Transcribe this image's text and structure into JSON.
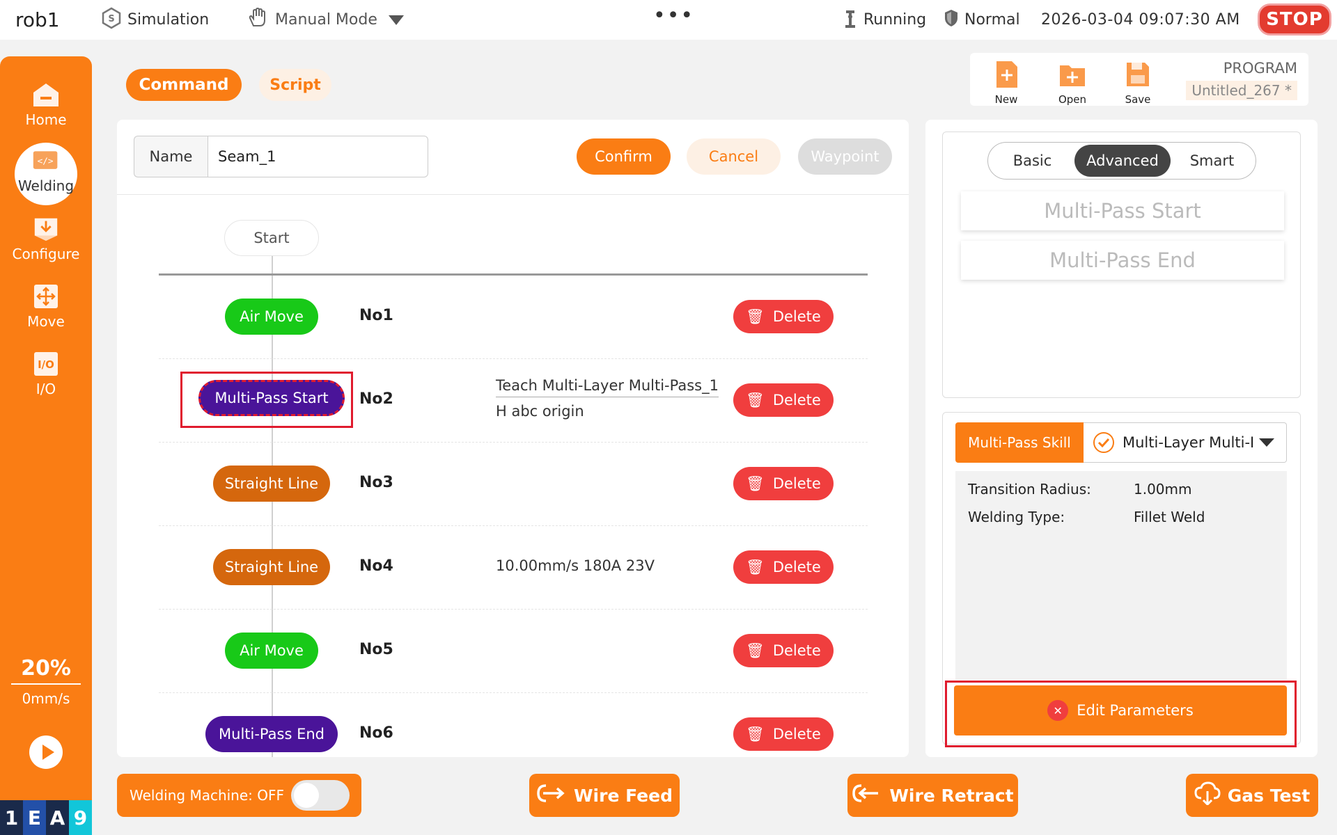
{
  "topbar": {
    "robot_name": "rob1",
    "simulation": "Simulation",
    "mode": "Manual Mode",
    "more": "•••",
    "state": "Running",
    "safety": "Normal",
    "datetime": "2026-03-04 09:07:30 AM",
    "stop": "STOP"
  },
  "sidebar": {
    "items": [
      {
        "label": "Home"
      },
      {
        "label": "Welding"
      },
      {
        "label": "Configure"
      },
      {
        "label": "Move"
      },
      {
        "label": "I/O"
      }
    ],
    "speed_pct": "20%",
    "speed_mms": "0mm/s",
    "logo": [
      "1",
      "E",
      "A",
      "9"
    ]
  },
  "tabs": {
    "command": "Command",
    "script": "Script"
  },
  "program": {
    "new": "New",
    "open": "Open",
    "save": "Save",
    "label": "PROGRAM",
    "name": "Untitled_267 *"
  },
  "command": {
    "name_label": "Name",
    "name_value": "Seam_1",
    "confirm": "Confirm",
    "cancel": "Cancel",
    "waypoint": "Waypoint",
    "start": "Start",
    "delete_label": "Delete",
    "steps": [
      {
        "node": "Air Move",
        "no": "No1",
        "desc1": "",
        "desc2": ""
      },
      {
        "node": "Multi-Pass Start",
        "no": "No2",
        "desc1": "Teach Multi-Layer Multi-Pass_1",
        "desc2": "H abc origin"
      },
      {
        "node": "Straight Line",
        "no": "No3",
        "desc1": "",
        "desc2": ""
      },
      {
        "node": "Straight Line",
        "no": "No4",
        "desc1": "10.00mm/s 180A 23V",
        "desc2": ""
      },
      {
        "node": "Air Move",
        "no": "No5",
        "desc1": "",
        "desc2": ""
      },
      {
        "node": "Multi-Pass End",
        "no": "No6",
        "desc1": "",
        "desc2": ""
      }
    ]
  },
  "right": {
    "segments": [
      "Basic",
      "Advanced",
      "Smart"
    ],
    "skills": [
      "Multi-Pass Start",
      "Multi-Pass End"
    ],
    "mp_tab": "Multi-Pass Skill",
    "mp_select": "Multi-Layer Multi-I",
    "params": [
      {
        "label": "Transition Radius:",
        "value": "1.00mm"
      },
      {
        "label": "Welding Type:",
        "value": "Fillet Weld"
      }
    ],
    "edit": "Edit Parameters"
  },
  "bottom": {
    "welding_machine": "Welding Machine: OFF",
    "wire_feed": "Wire Feed",
    "wire_retract": "Wire Retract",
    "gas_test": "Gas Test"
  },
  "colors": {
    "accent": "#fa7d14",
    "danger": "#f03e3e",
    "green_node": "#18c918",
    "purple_node": "#4a1499",
    "orange_node": "#d5670d"
  }
}
